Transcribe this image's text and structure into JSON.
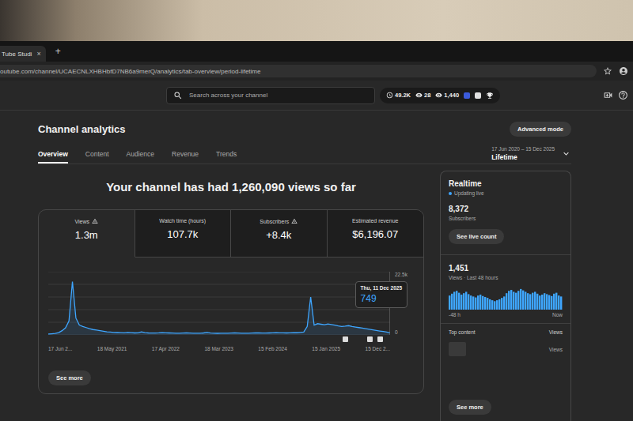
{
  "browser": {
    "tab": {
      "title": "Tube Studi",
      "close": "×"
    },
    "new_tab": "+",
    "url": "outube.com/channel/UCAECNLXHBHbfD7NB6a9merQ/analytics/tab-overview/period-lifetime"
  },
  "header": {
    "search": {
      "placeholder": "Search across your channel"
    },
    "stats": [
      "49.2K",
      "28",
      "1,440"
    ]
  },
  "page": {
    "title": "Channel analytics",
    "advanced_button": "Advanced mode"
  },
  "tabs": [
    {
      "label": "Overview",
      "selected": true
    },
    {
      "label": "Content",
      "selected": false
    },
    {
      "label": "Audience",
      "selected": false
    },
    {
      "label": "Revenue",
      "selected": false
    },
    {
      "label": "Trends",
      "selected": false
    }
  ],
  "date_range": {
    "range": "17 Jun 2020 – 15 Dec 2025",
    "period": "Lifetime"
  },
  "headline": "Your channel has had 1,260,090 views so far",
  "metrics": [
    {
      "label": "Views",
      "value": "1.3m",
      "warning": true,
      "selected": true
    },
    {
      "label": "Watch time (hours)",
      "value": "107.7k",
      "warning": false,
      "selected": false
    },
    {
      "label": "Subscribers",
      "value": "+8.4k",
      "warning": true,
      "selected": false
    },
    {
      "label": "Estimated revenue",
      "value": "$6,196.07",
      "warning": false,
      "selected": false
    }
  ],
  "chart": {
    "max": 22500,
    "y_ticks": [
      "22.5k",
      "0"
    ],
    "x_labels": [
      "17 Jun 2...",
      "18 May 2021",
      "17 Apr 2022",
      "18 Mar 2023",
      "15 Feb 2024",
      "15 Jan 2025",
      "15 Dec 2..."
    ],
    "values": [
      300,
      400,
      500,
      800,
      1500,
      2500,
      5000,
      19000,
      6000,
      3500,
      3000,
      2600,
      2200,
      1900,
      1700,
      1500,
      1300,
      1100,
      1000,
      900,
      850,
      800,
      760,
      900,
      820,
      700,
      750,
      1100,
      780,
      700,
      650,
      690,
      720,
      800,
      760,
      700,
      640,
      600,
      620,
      680,
      700,
      650,
      600,
      580,
      620,
      700,
      900,
      640,
      600,
      560,
      580,
      620,
      600,
      640,
      700,
      680,
      620,
      600,
      580,
      640,
      700,
      720,
      680,
      650,
      700,
      760,
      800,
      750,
      720,
      700,
      760,
      820,
      780,
      900,
      1000,
      3000,
      13500,
      3500,
      4000,
      3800,
      3600,
      3900,
      3700,
      3500,
      3200,
      3000,
      3100,
      3300,
      3000,
      2800,
      2600,
      2400,
      2200,
      2000,
      1800,
      1600,
      1400,
      1200,
      1000,
      749
    ],
    "markers": [
      86,
      93,
      96
    ],
    "tooltip": {
      "date": "Thu, 11 Dec 2025",
      "value": "749",
      "index": 99
    }
  },
  "see_more": "See more",
  "realtime": {
    "title": "Realtime",
    "status": "Updating live",
    "subscribers": {
      "value": "8,372",
      "label": "Subscribers"
    },
    "live_button": "See live count",
    "views": {
      "value": "1,451",
      "label": "Views · Last 48 hours"
    },
    "bars": [
      30,
      34,
      38,
      40,
      36,
      32,
      35,
      38,
      33,
      30,
      28,
      26,
      30,
      32,
      29,
      27,
      25,
      22,
      20,
      18,
      20,
      22,
      25,
      28,
      35,
      40,
      42,
      38,
      36,
      40,
      44,
      41,
      38,
      35,
      33,
      36,
      38,
      34,
      30,
      32,
      35,
      33,
      31,
      29,
      34,
      36,
      30,
      28
    ],
    "axis": [
      "-48 h",
      "Now"
    ],
    "top_content": {
      "title": "Top content",
      "column": "Views",
      "rows": [
        "Views"
      ]
    },
    "see_more": "See more"
  }
}
